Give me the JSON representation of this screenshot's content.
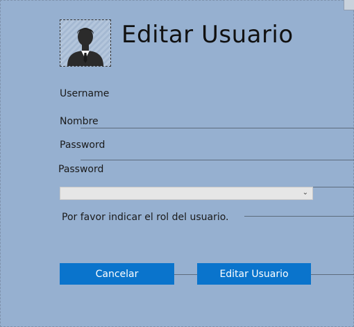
{
  "title": "Editar Usuario",
  "fields": {
    "username_label": "Username",
    "nombre_label": "Nombre",
    "password_label": "Password",
    "password_confirm_label": "Password",
    "role_hint": "Por favor indicar el rol del usuario."
  },
  "role_select": {
    "selected": ""
  },
  "buttons": {
    "cancel": "Cancelar",
    "submit": "Editar Usuario"
  },
  "icons": {
    "avatar": "user-avatar-icon",
    "dropdown": "chevron-down-icon"
  },
  "colors": {
    "background": "#96b0d0",
    "button": "#0a74cc"
  }
}
